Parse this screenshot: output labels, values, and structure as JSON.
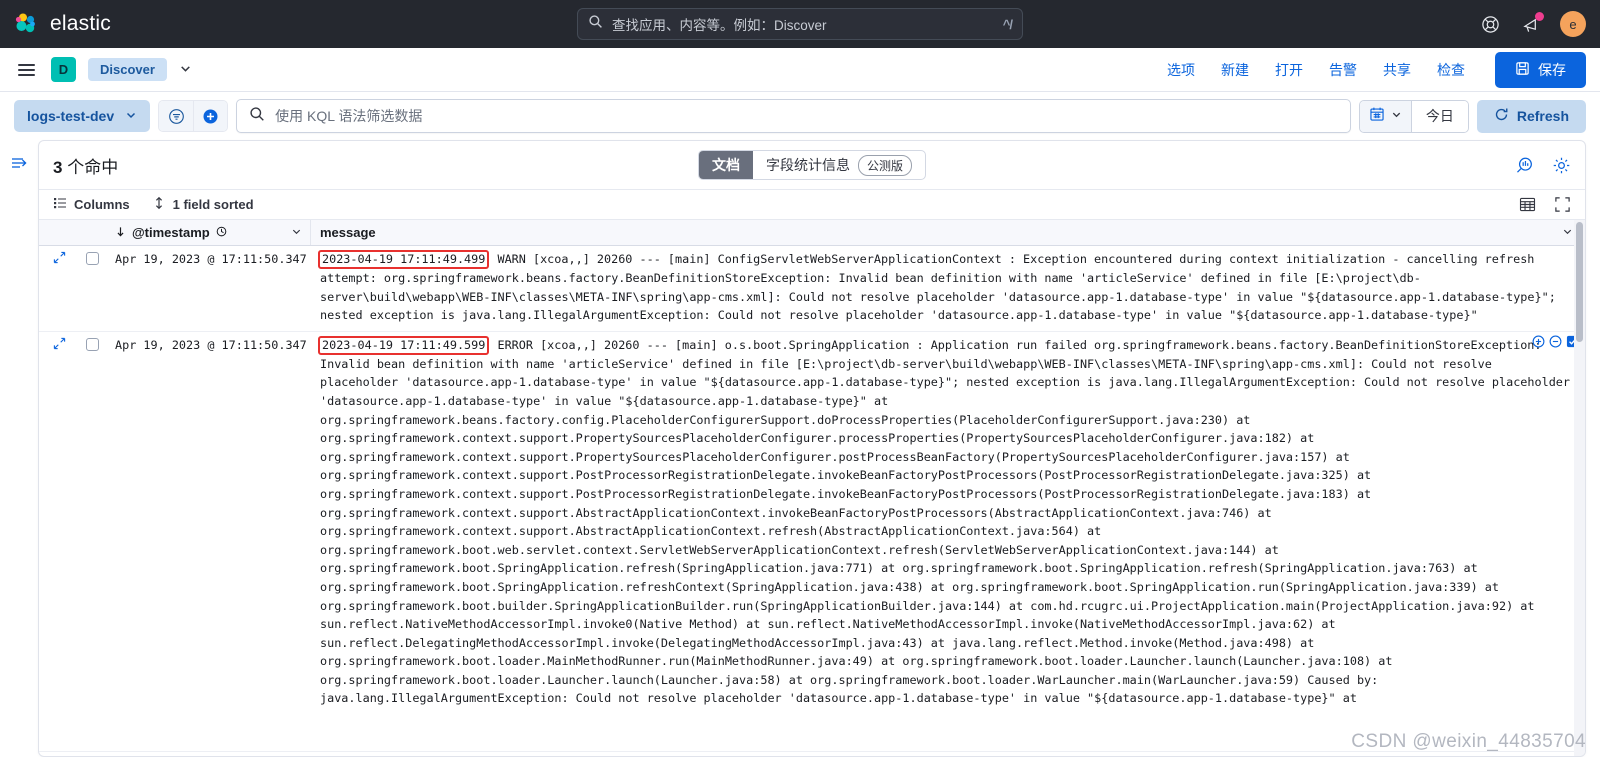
{
  "header": {
    "brand": "elastic",
    "search_placeholder": "查找应用、内容等。例如：Discover",
    "search_shortcut": "^/",
    "help_icon": "help-lifebuoy-icon",
    "news_icon": "news-megaphone-icon",
    "avatar_initial": "e",
    "colors": {
      "bar_bg": "#25282f",
      "accent": "#0b64dd",
      "avatar": "#f5a35c",
      "notification": "#ee3d8f"
    }
  },
  "nav": {
    "app_initial": "D",
    "breadcrumb": "Discover",
    "links": [
      "选项",
      "新建",
      "打开",
      "告警",
      "共享",
      "检查"
    ],
    "save_label": "保存"
  },
  "query": {
    "data_view": "logs-test-dev",
    "kql_placeholder": "使用 KQL 语法筛选数据",
    "date_value": "今日",
    "refresh_label": "Refresh"
  },
  "panel": {
    "hits_count": "3",
    "hits_label": "个命中",
    "tabs": [
      {
        "label": "文档",
        "active": true,
        "badge": ""
      },
      {
        "label": "字段统计信息",
        "active": false,
        "badge": "公测版"
      }
    ],
    "toolbar": {
      "columns_label": "Columns",
      "sort_label": "1 field sorted"
    },
    "columns": [
      {
        "key": "timestamp",
        "label": "@timestamp"
      },
      {
        "key": "message",
        "label": "message"
      }
    ],
    "rows": [
      {
        "timestamp": "Apr 19, 2023 @ 17:11:50.347",
        "highlight": "2023-04-19 17:11:49.499",
        "message": " WARN [xcoa,,] 20260 --- [main] ConfigServletWebServerApplicationContext : Exception encountered during context initialization - cancelling refresh attempt: org.springframework.beans.factory.BeanDefinitionStoreException: Invalid bean definition with name 'articleService' defined in file [E:\\project\\db-server\\build\\webapp\\WEB-INF\\classes\\META-INF\\spring\\app-cms.xml]: Could not resolve placeholder 'datasource.app-1.database-type' in value \"${datasource.app-1.database-type}\"; nested exception is java.lang.IllegalArgumentException: Could not resolve placeholder 'datasource.app-1.database-type' in value \"${datasource.app-1.database-type}\"",
        "has_actions": false
      },
      {
        "timestamp": "Apr 19, 2023 @ 17:11:50.347",
        "highlight": "2023-04-19 17:11:49.599",
        "message": " ERROR [xcoa,,] 20260 --- [main] o.s.boot.SpringApplication : Application run failed org.springframework.beans.factory.BeanDefinitionStoreException: Invalid bean definition with name 'articleService' defined in file [E:\\project\\db-server\\build\\webapp\\WEB-INF\\classes\\META-INF\\spring\\app-cms.xml]: Could not resolve placeholder 'datasource.app-1.database-type' in value \"${datasource.app-1.database-type}\"; nested exception is java.lang.IllegalArgumentException: Could not resolve placeholder 'datasource.app-1.database-type' in value \"${datasource.app-1.database-type}\" at org.springframework.beans.factory.config.PlaceholderConfigurerSupport.doProcessProperties(PlaceholderConfigurerSupport.java:230) at org.springframework.context.support.PropertySourcesPlaceholderConfigurer.processProperties(PropertySourcesPlaceholderConfigurer.java:182) at org.springframework.context.support.PropertySourcesPlaceholderConfigurer.postProcessBeanFactory(PropertySourcesPlaceholderConfigurer.java:157) at org.springframework.context.support.PostProcessorRegistrationDelegate.invokeBeanFactoryPostProcessors(PostProcessorRegistrationDelegate.java:325) at org.springframework.context.support.PostProcessorRegistrationDelegate.invokeBeanFactoryPostProcessors(PostProcessorRegistrationDelegate.java:183) at org.springframework.context.support.AbstractApplicationContext.invokeBeanFactoryPostProcessors(AbstractApplicationContext.java:746) at org.springframework.context.support.AbstractApplicationContext.refresh(AbstractApplicationContext.java:564) at org.springframework.boot.web.servlet.context.ServletWebServerApplicationContext.refresh(ServletWebServerApplicationContext.java:144) at org.springframework.boot.SpringApplication.refresh(SpringApplication.java:771) at org.springframework.boot.SpringApplication.refresh(SpringApplication.java:763) at org.springframework.boot.SpringApplication.refreshContext(SpringApplication.java:438) at org.springframework.boot.SpringApplication.run(SpringApplication.java:339) at org.springframework.boot.builder.SpringApplicationBuilder.run(SpringApplicationBuilder.java:144) at com.hd.rcugrc.ui.ProjectApplication.main(ProjectApplication.java:92) at sun.reflect.NativeMethodAccessorImpl.invoke0(Native Method) at sun.reflect.NativeMethodAccessorImpl.invoke(NativeMethodAccessorImpl.java:62) at sun.reflect.DelegatingMethodAccessorImpl.invoke(DelegatingMethodAccessorImpl.java:43) at java.lang.reflect.Method.invoke(Method.java:498) at org.springframework.boot.loader.MainMethodRunner.run(MainMethodRunner.java:49) at org.springframework.boot.loader.Launcher.launch(Launcher.java:108) at org.springframework.boot.loader.Launcher.launch(Launcher.java:58) at org.springframework.boot.loader.WarLauncher.main(WarLauncher.java:59) Caused by: java.lang.IllegalArgumentException: Could not resolve placeholder 'datasource.app-1.database-type' in value \"${datasource.app-1.database-type}\" at",
        "has_actions": true
      }
    ],
    "row_action_icons": [
      "filter-for-value-icon",
      "filter-out-value-icon",
      "toggle-column-icon"
    ],
    "head_icons": [
      "inspect-chart-icon",
      "grid-settings-gear-icon"
    ],
    "toolbar_icons": [
      "display-density-icon",
      "fullscreen-icon"
    ],
    "highlight_color": "#e8312f"
  },
  "watermark": "CSDN @weixin_44835704"
}
